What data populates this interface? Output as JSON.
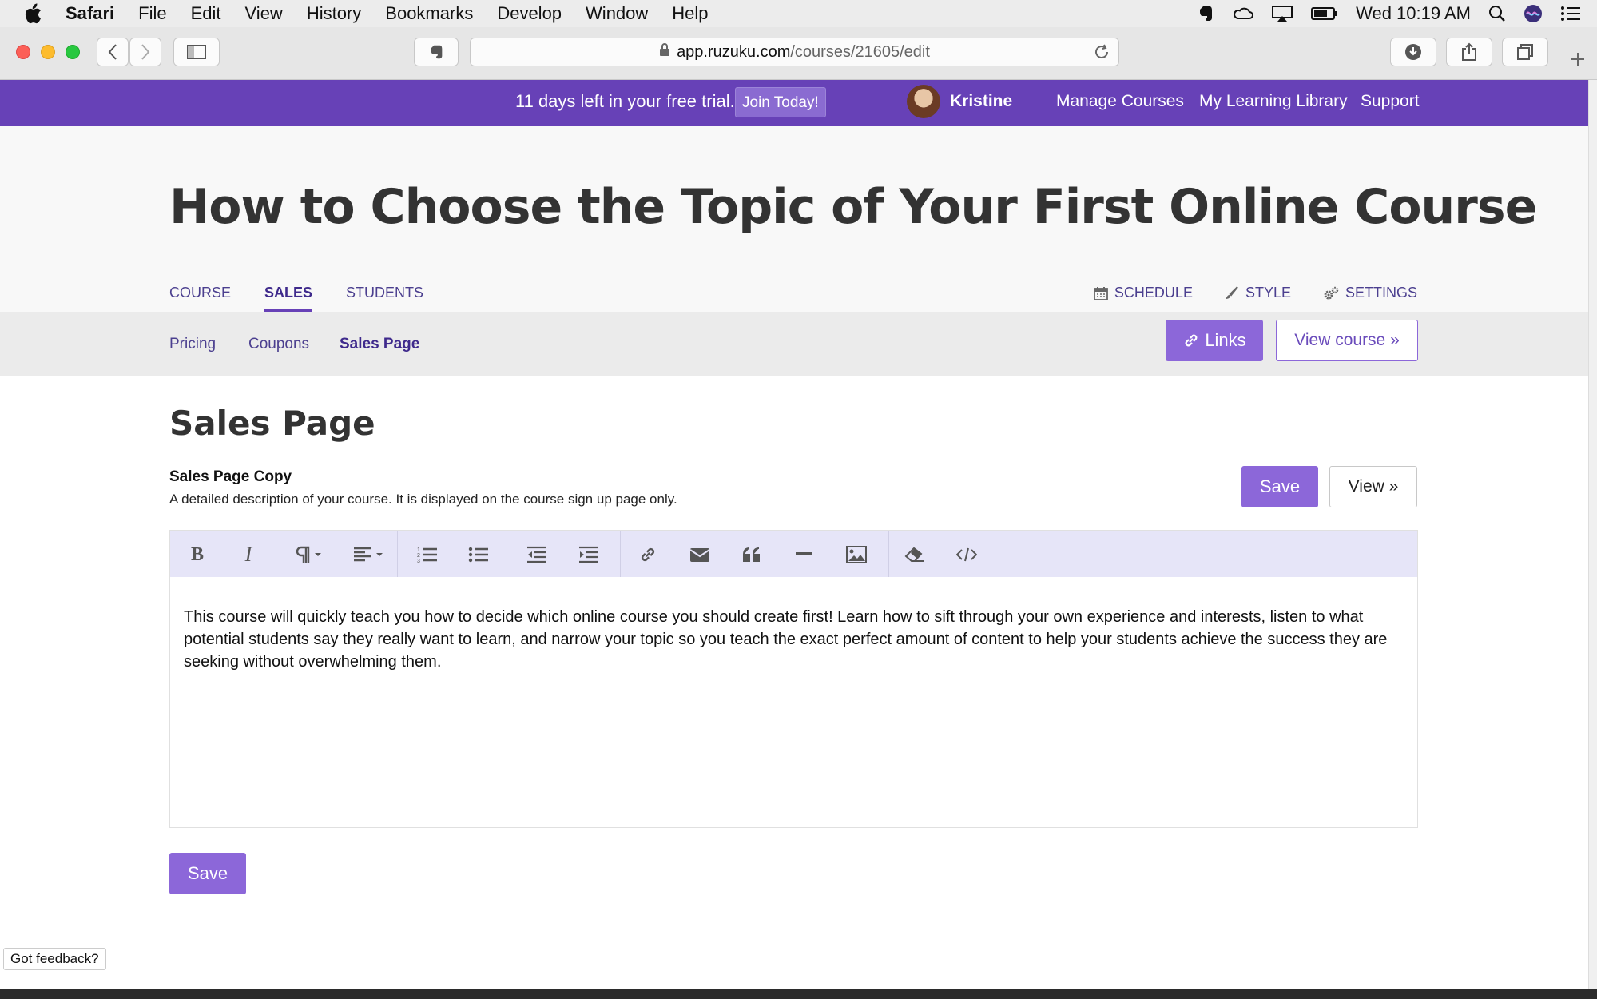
{
  "menubar": {
    "app_name": "Safari",
    "items": [
      "File",
      "Edit",
      "View",
      "History",
      "Bookmarks",
      "Develop",
      "Window",
      "Help"
    ],
    "clock": "Wed 10:19 AM"
  },
  "browser": {
    "url_host": "app.ruzuku.com",
    "url_path": "/courses/21605/edit"
  },
  "topbar": {
    "trial_text": "11 days left in your free trial.",
    "join_label": "Join Today!",
    "username": "Kristine",
    "nav": [
      "Manage Courses",
      "My Learning Library",
      "Support"
    ]
  },
  "header": {
    "course_title": "How to Choose the Topic of Your First Online Course",
    "tabs": [
      "COURSE",
      "SALES",
      "STUDENTS"
    ],
    "active_tab": "SALES",
    "tools": [
      "SCHEDULE",
      "STYLE",
      "SETTINGS"
    ]
  },
  "subnav": {
    "items": [
      "Pricing",
      "Coupons",
      "Sales Page"
    ],
    "active": "Sales Page",
    "links_label": "Links",
    "view_course_label": "View course »"
  },
  "content": {
    "section_title": "Sales Page",
    "field_label": "Sales Page Copy",
    "field_help": "A detailed description of your course. It is displayed on the course sign up page only.",
    "save_label": "Save",
    "view_label": "View »",
    "editor_text": "This course will quickly teach you how to decide which online course you should create first! Learn how to sift through your own experience and interests, listen to what potential students say they really want to learn, and narrow your topic so you teach the exact perfect amount of content to help your students achieve the success they are seeking without overwhelming them.",
    "bottom_save_label": "Save"
  },
  "feedback": {
    "label": "Got feedback?"
  },
  "colors": {
    "brand_purple": "#6741b7",
    "button_purple": "#8c67d9",
    "toolbar_bg": "#e6e5f8"
  }
}
